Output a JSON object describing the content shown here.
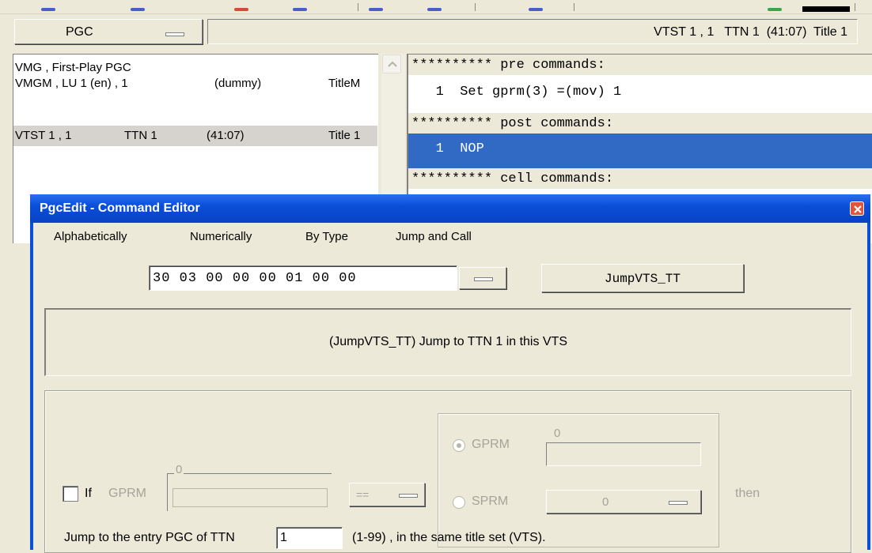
{
  "main": {
    "pgc_button_label": "PGC",
    "status_text": "VTST 1 , 1   TTN 1  (41:07)  Title 1",
    "pgc_list": [
      {
        "text": "VMG , First-Play PGC",
        "selected": false
      },
      {
        "col1": "VMGM , LU 1 (en) , 1",
        "col2": "(dummy)",
        "col3": "TitleM",
        "selected": false
      },
      {
        "col1": "VTST 1 , 1",
        "col2": "TTN 1",
        "col3": "(41:07)",
        "col4": "Title 1",
        "selected": true
      }
    ],
    "command_lines": [
      {
        "text": "********** pre commands:",
        "type": "header"
      },
      {
        "text": "   1  Set gprm(3) =(mov) 1",
        "type": "cmd"
      },
      {
        "text": "********** post commands:",
        "type": "header"
      },
      {
        "text": "   1  NOP",
        "type": "cmd",
        "selected": true
      },
      {
        "text": "********** cell commands:",
        "type": "header"
      }
    ]
  },
  "dialog": {
    "title": "PgcEdit - Command Editor",
    "menu": [
      "Alphabetically",
      "Numerically",
      "By Type",
      "Jump and Call"
    ],
    "hex_value": "30 03 00 00 00 01 00 00",
    "command_button_label": "JumpVTS_TT",
    "description": "(JumpVTS_TT) Jump to TTN 1 in this VTS",
    "if_label": "If",
    "gprm_label_1": "GPRM",
    "gprm_value_1": "0",
    "compare_op": "==",
    "gprm_label_2": "GPRM",
    "gprm_value_2": "0",
    "sprm_label": "SPRM",
    "sprm_value": "0",
    "then_label": "then",
    "jump_label": "Jump to the entry PGC of TTN",
    "ttn_value": "1",
    "range_label": "(1-99) , in the same title set (VTS)."
  },
  "colors": {
    "title_bar": "#0a4fd8",
    "selection": "#316ac5",
    "row_selected": "#d6d3ce"
  }
}
